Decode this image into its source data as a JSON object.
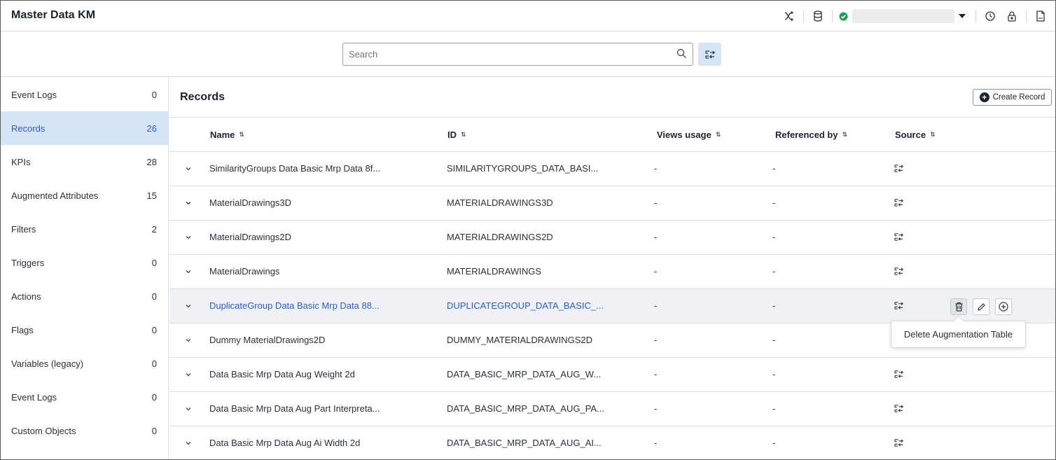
{
  "app": {
    "title": "Master Data KM"
  },
  "header": {
    "icons": [
      "shuffle-icon",
      "database-icon",
      "status-ok-icon",
      "history-icon",
      "lock-icon",
      "file-icon"
    ],
    "env_status_color": "#1f9d55"
  },
  "search": {
    "placeholder": "Search",
    "value": ""
  },
  "sidebar": {
    "items": [
      {
        "label": "Event Logs",
        "count": "0"
      },
      {
        "label": "Records",
        "count": "26"
      },
      {
        "label": "KPIs",
        "count": "28"
      },
      {
        "label": "Augmented Attributes",
        "count": "15"
      },
      {
        "label": "Filters",
        "count": "2"
      },
      {
        "label": "Triggers",
        "count": "0"
      },
      {
        "label": "Actions",
        "count": "0"
      },
      {
        "label": "Flags",
        "count": "0"
      },
      {
        "label": "Variables (legacy)",
        "count": "0"
      },
      {
        "label": "Event Logs",
        "count": "0"
      },
      {
        "label": "Custom Objects",
        "count": "0"
      }
    ],
    "active_index": 1
  },
  "main": {
    "title": "Records",
    "create_label": "Create Record",
    "columns": {
      "name": "Name",
      "id": "ID",
      "views": "Views usage",
      "ref": "Referenced by",
      "source": "Source"
    },
    "rows": [
      {
        "name": "SimilarityGroups Data Basic Mrp Data 8f...",
        "id": "SIMILARITYGROUPS_DATA_BASI...",
        "views": "-",
        "ref": "-"
      },
      {
        "name": "MaterialDrawings3D",
        "id": "MATERIALDRAWINGS3D",
        "views": "-",
        "ref": "-"
      },
      {
        "name": "MaterialDrawings2D",
        "id": "MATERIALDRAWINGS2D",
        "views": "-",
        "ref": "-"
      },
      {
        "name": "MaterialDrawings",
        "id": "MATERIALDRAWINGS",
        "views": "-",
        "ref": "-"
      },
      {
        "name": "DuplicateGroup Data Basic Mrp Data 88...",
        "id": "DUPLICATEGROUP_DATA_BASIC_...",
        "views": "-",
        "ref": "-"
      },
      {
        "name": "Dummy MaterialDrawings2D",
        "id": "DUMMY_MATERIALDRAWINGS2D",
        "views": "-",
        "ref": "-"
      },
      {
        "name": "Data Basic Mrp Data Aug Weight 2d",
        "id": "DATA_BASIC_MRP_DATA_AUG_W...",
        "views": "-",
        "ref": "-"
      },
      {
        "name": "Data Basic Mrp Data Aug Part Interpreta...",
        "id": "DATA_BASIC_MRP_DATA_AUG_PA...",
        "views": "-",
        "ref": "-"
      },
      {
        "name": "Data Basic Mrp Data Aug Ai Width 2d",
        "id": "DATA_BASIC_MRP_DATA_AUG_AI...",
        "views": "-",
        "ref": "-"
      }
    ],
    "hover_row": 4,
    "tooltip": "Delete Augmentation Table"
  },
  "colors": {
    "accent": "#2b5cc7",
    "active_bg": "#d6e4f7"
  }
}
